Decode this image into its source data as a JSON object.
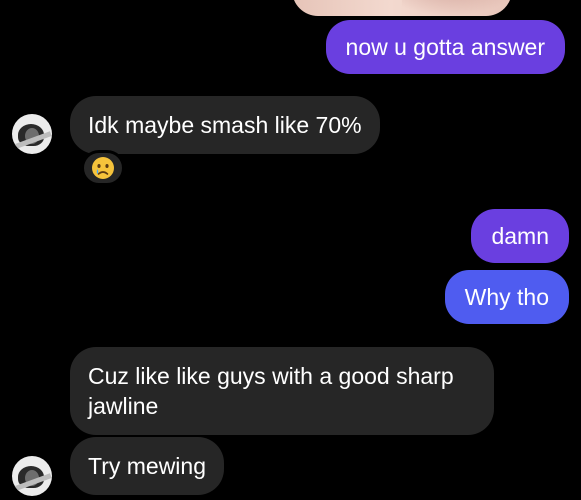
{
  "messages": [
    {
      "id": "m1",
      "direction": "outgoing",
      "text": "now u gotta answer"
    },
    {
      "id": "m2",
      "direction": "incoming",
      "text": "Idk maybe smash like 70%"
    },
    {
      "id": "m3",
      "direction": "outgoing",
      "text": "damn"
    },
    {
      "id": "m4",
      "direction": "outgoing",
      "text": "Why tho"
    },
    {
      "id": "m5",
      "direction": "incoming",
      "text": "Cuz like like guys with a good sharp jawline"
    },
    {
      "id": "m6",
      "direction": "incoming",
      "text": "Try mewing"
    }
  ],
  "reactions": [
    {
      "message_id": "m2",
      "emoji_name": "crying-face-emoji"
    }
  ],
  "colors": {
    "background": "#000000",
    "outgoing_bubble_purple": "#6a3fe0",
    "outgoing_bubble_blue": "#4f5cf0",
    "incoming_bubble": "#262626",
    "text": "#ffffff"
  }
}
